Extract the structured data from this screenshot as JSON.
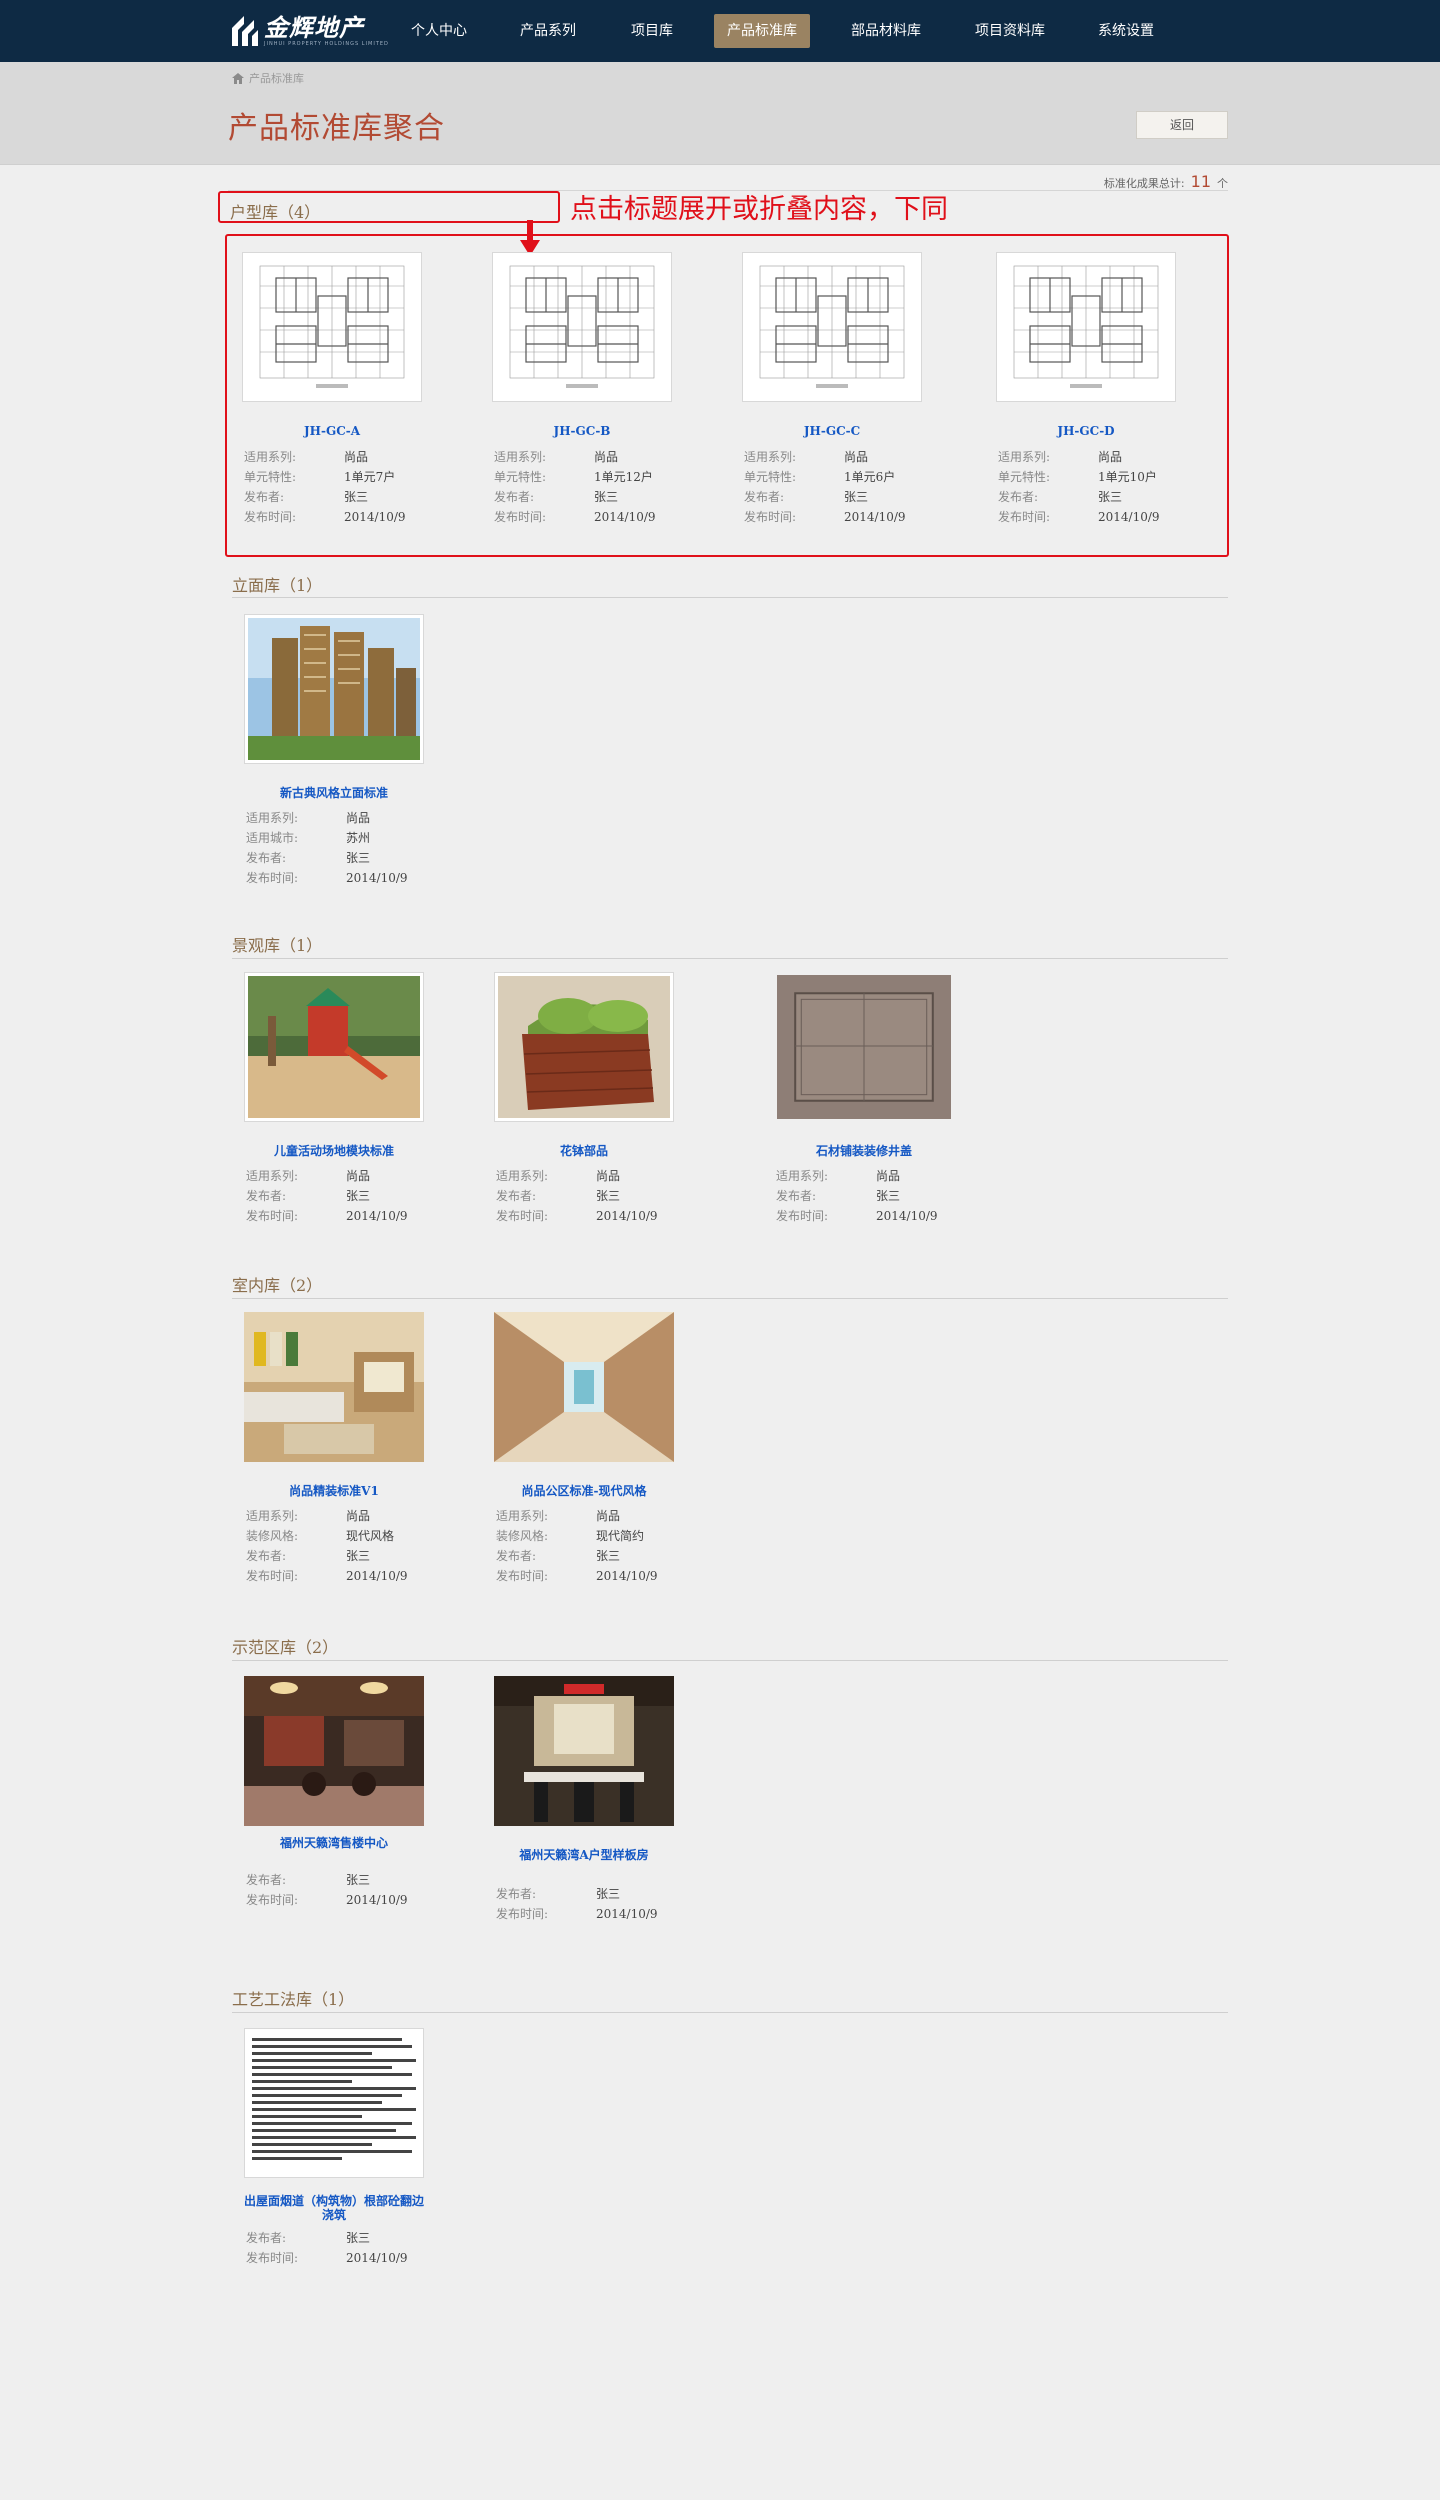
{
  "brand": {
    "name": "金辉地产",
    "subtitle": "JINHUI PROPERTY HOLDINGS LIMITED"
  },
  "nav": [
    "个人中心",
    "产品系列",
    "项目库",
    "产品标准库",
    "部品材料库",
    "项目资料库",
    "系统设置"
  ],
  "nav_active": "产品标准库",
  "breadcrumb": "产品标准库",
  "page_title": "产品标准库聚合",
  "back_label": "返回",
  "total": {
    "label": "标准化成果总计:",
    "value": "11",
    "unit": "个"
  },
  "annotation": "点击标题展开或折叠内容，下同",
  "sections": [
    {
      "title": "户型库（4）",
      "items": [
        {
          "title": "JH-GC-A",
          "meta": [
            [
              "适用系列:",
              "尚品"
            ],
            [
              "单元特性:",
              "1单元7户"
            ],
            [
              "发布者:",
              "张三"
            ],
            [
              "发布时间:",
              "2014/10/9"
            ]
          ]
        },
        {
          "title": "JH-GC-B",
          "meta": [
            [
              "适用系列:",
              "尚品"
            ],
            [
              "单元特性:",
              "1单元12户"
            ],
            [
              "发布者:",
              "张三"
            ],
            [
              "发布时间:",
              "2014/10/9"
            ]
          ]
        },
        {
          "title": "JH-GC-C",
          "meta": [
            [
              "适用系列:",
              "尚品"
            ],
            [
              "单元特性:",
              "1单元6户"
            ],
            [
              "发布者:",
              "张三"
            ],
            [
              "发布时间:",
              "2014/10/9"
            ]
          ]
        },
        {
          "title": "JH-GC-D",
          "meta": [
            [
              "适用系列:",
              "尚品"
            ],
            [
              "单元特性:",
              "1单元10户"
            ],
            [
              "发布者:",
              "张三"
            ],
            [
              "发布时间:",
              "2014/10/9"
            ]
          ]
        }
      ]
    },
    {
      "title": "立面库（1）",
      "items": [
        {
          "title": "新古典风格立面标准",
          "meta": [
            [
              "适用系列:",
              "尚品"
            ],
            [
              "适用城市:",
              "苏州"
            ],
            [
              "发布者:",
              "张三"
            ],
            [
              "发布时间:",
              "2014/10/9"
            ]
          ]
        }
      ]
    },
    {
      "title": "景观库（1）",
      "items": [
        {
          "title": "儿童活动场地模块标准",
          "meta": [
            [
              "适用系列:",
              "尚品"
            ],
            [
              "发布者:",
              "张三"
            ],
            [
              "发布时间:",
              "2014/10/9"
            ]
          ]
        },
        {
          "title": "花钵部品",
          "meta": [
            [
              "适用系列:",
              "尚品"
            ],
            [
              "发布者:",
              "张三"
            ],
            [
              "发布时间:",
              "2014/10/9"
            ]
          ]
        },
        {
          "title": "石材铺装装修井盖",
          "meta": [
            [
              "适用系列:",
              "尚品"
            ],
            [
              "发布者:",
              "张三"
            ],
            [
              "发布时间:",
              "2014/10/9"
            ]
          ]
        }
      ]
    },
    {
      "title": "室内库（2）",
      "items": [
        {
          "title": "尚品精装标准V1",
          "meta": [
            [
              "适用系列:",
              "尚品"
            ],
            [
              "装修风格:",
              "现代风格"
            ],
            [
              "发布者:",
              "张三"
            ],
            [
              "发布时间:",
              "2014/10/9"
            ]
          ]
        },
        {
          "title": "尚品公区标准-现代风格",
          "meta": [
            [
              "适用系列:",
              "尚品"
            ],
            [
              "装修风格:",
              "现代简约"
            ],
            [
              "发布者:",
              "张三"
            ],
            [
              "发布时间:",
              "2014/10/9"
            ]
          ]
        }
      ]
    },
    {
      "title": "示范区库（2）",
      "items": [
        {
          "title": "福州天籁湾售楼中心",
          "meta": [
            [
              "发布者:",
              "张三"
            ],
            [
              "发布时间:",
              "2014/10/9"
            ]
          ]
        },
        {
          "title": "福州天籁湾A户型样板房",
          "meta": [
            [
              "发布者:",
              "张三"
            ],
            [
              "发布时间:",
              "2014/10/9"
            ]
          ]
        }
      ]
    },
    {
      "title": "工艺工法库（1）",
      "items": [
        {
          "title": "出屋面烟道（构筑物）根部砼翻边浇筑",
          "meta": [
            [
              "发布者:",
              "张三"
            ],
            [
              "发布时间:",
              "2014/10/9"
            ]
          ]
        }
      ]
    }
  ]
}
